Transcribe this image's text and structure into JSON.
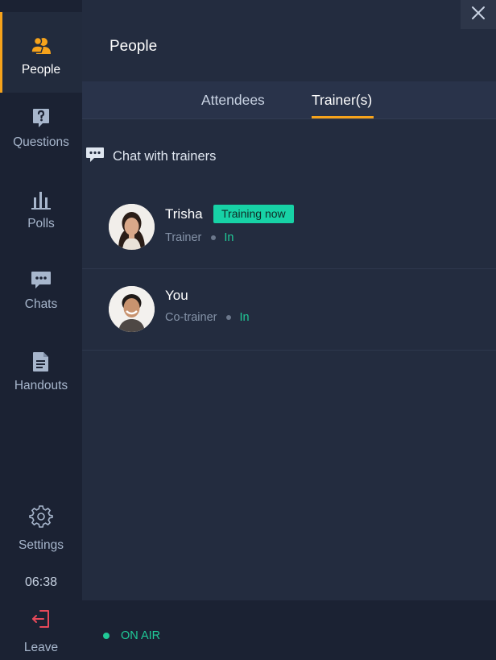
{
  "sidebar": {
    "items": [
      {
        "label": "People",
        "icon": "people-icon"
      },
      {
        "label": "Questions",
        "icon": "question-icon"
      },
      {
        "label": "Polls",
        "icon": "polls-icon"
      },
      {
        "label": "Chats",
        "icon": "chat-icon"
      },
      {
        "label": "Handouts",
        "icon": "handout-icon"
      }
    ],
    "settings_label": "Settings",
    "clock": "06:38",
    "leave_label": "Leave"
  },
  "header": {
    "title": "People"
  },
  "tabs": [
    {
      "label": "Attendees",
      "active": false
    },
    {
      "label": "Trainer(s)",
      "active": true
    }
  ],
  "chat": {
    "label": "Chat with trainers"
  },
  "people": [
    {
      "name": "Trisha",
      "badge": "Training now",
      "role": "Trainer",
      "status": "In"
    },
    {
      "name": "You",
      "badge": "",
      "role": "Co-trainer",
      "status": "In"
    }
  ],
  "footer": {
    "status": "ON AIR"
  },
  "colors": {
    "accent": "#f6a31b",
    "online": "#20c997",
    "badge": "#17d2a6",
    "leave": "#e8495a",
    "background": "#232c3f",
    "sidebar": "#1b2233"
  }
}
